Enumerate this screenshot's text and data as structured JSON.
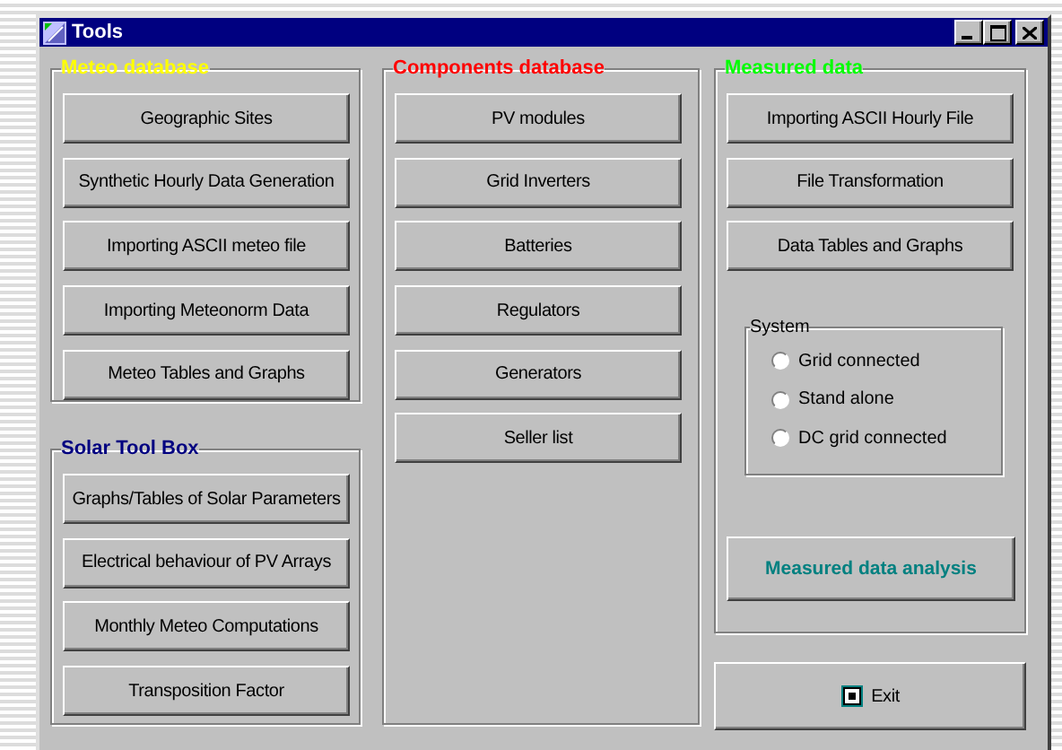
{
  "window": {
    "title": "Tools"
  },
  "meteo_database": {
    "title": "Meteo database",
    "color": "#ffff00",
    "buttons": [
      "Geographic Sites",
      "Synthetic Hourly Data Generation",
      "Importing ASCII meteo file",
      "Importing Meteonorm Data",
      "Meteo Tables and Graphs"
    ]
  },
  "solar_tool_box": {
    "title": "Solar Tool Box",
    "color": "#000080",
    "buttons": [
      "Graphs/Tables of Solar Parameters",
      "Electrical behaviour of PV Arrays",
      "Monthly Meteo Computations",
      "Transposition Factor"
    ]
  },
  "components_database": {
    "title": "Components database",
    "color": "#ff0000",
    "buttons": [
      "PV modules",
      "Grid Inverters",
      "Batteries",
      "Regulators",
      "Generators",
      "Seller list"
    ]
  },
  "measured_data": {
    "title": "Measured data",
    "color": "#00ff00",
    "buttons": [
      "Importing ASCII Hourly File",
      "File Transformation",
      "Data Tables and Graphs"
    ],
    "system": {
      "title": "System",
      "options": [
        {
          "label": "Grid connected",
          "selected": false
        },
        {
          "label": "Stand alone",
          "selected": false
        },
        {
          "label": "DC grid  connected",
          "selected": false
        }
      ]
    },
    "analysis_button": {
      "label": "Measured data analysis",
      "color": "#008080"
    }
  },
  "exit_button": {
    "label": "Exit"
  }
}
